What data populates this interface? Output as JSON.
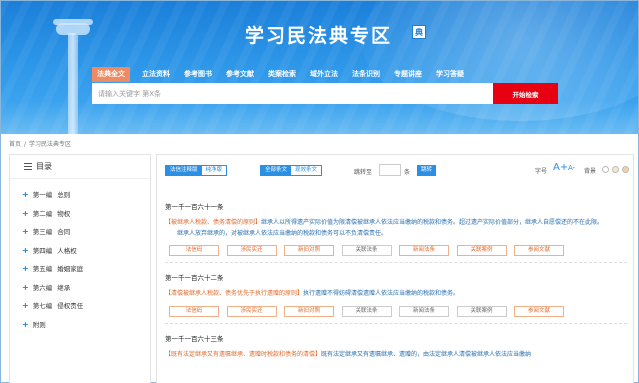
{
  "site": {
    "title": "学习民法典专区",
    "badge": "典"
  },
  "nav": {
    "items": [
      "法典全文",
      "立法资料",
      "参考图书",
      "参考文献",
      "类案检索",
      "域外立法",
      "法条识别",
      "专题讲座",
      "学习答疑"
    ],
    "active_index": 0
  },
  "search": {
    "placeholder": "请输入关键字 第X条",
    "button": "开始检索"
  },
  "breadcrumb": {
    "home": "首页",
    "sep": "/",
    "current": "学习民法典专区"
  },
  "sidebar": {
    "title": "目录",
    "items": [
      {
        "part": "第一编",
        "name": "总则"
      },
      {
        "part": "第二编",
        "name": "物权"
      },
      {
        "part": "第三编",
        "name": "合同"
      },
      {
        "part": "第四编",
        "name": "人格权"
      },
      {
        "part": "第五编",
        "name": "婚姻家庭"
      },
      {
        "part": "第六编",
        "name": "继承"
      },
      {
        "part": "第七编",
        "name": "侵权责任"
      },
      {
        "part": "",
        "name": "附则"
      }
    ]
  },
  "toolbar": {
    "mode_on": "法信注释版",
    "mode_off": "纯净版",
    "scope_on": "全部条文",
    "scope_off": "现效条文",
    "jump_label": "跳转至",
    "jump_value": "",
    "jump_unit": "条",
    "jump_button": "跳转",
    "font_label": "字号",
    "font_plus": "A+",
    "font_minus": "A-",
    "bg_label": "背景",
    "bg_colors": [
      "#ffffff",
      "#f7e7c8",
      "#f3d3a6",
      "#e9e9e9"
    ]
  },
  "articles": [
    {
      "title": "第一千一百六十一条",
      "head": "【被继承人税款、债务清偿的原则】",
      "body": "继承人以所得遗产实际价值为限清偿被继承人依法应当缴纳的税款和债务。超过遗产实际价值部分，继承人自愿偿还的不在此限。",
      "extra": "继承人放弃继承的，对被继承人依法应当缴纳的税款和债务可以不负清偿责任。",
      "chips": [
        "法信码",
        "涉民实还",
        "新旧对照",
        "关联法条",
        "新阅法条",
        "关联案例",
        "参阅文献"
      ]
    },
    {
      "title": "第一千一百六十二条",
      "head": "【清偿被继承人税款、债务优先于执行遗赠的原则】",
      "body": "执行遗赠不得妨碍清偿遗赠人依法应当缴纳的税款和债务。",
      "extra": "",
      "chips": [
        "法信码",
        "涉民实还",
        "新旧对照",
        "关联法条",
        "新阅法条",
        "关联案例",
        "参阅文献"
      ]
    },
    {
      "title": "第一千一百六十三条",
      "head": "【既有法定继承又有遗嘱继承、遗赠时税款和债务的清偿】",
      "body": "既有法定继承又有遗嘱继承、遗赠的，由法定继承人清偿被继承人依法应当缴纳",
      "extra": "",
      "chips": []
    }
  ]
}
